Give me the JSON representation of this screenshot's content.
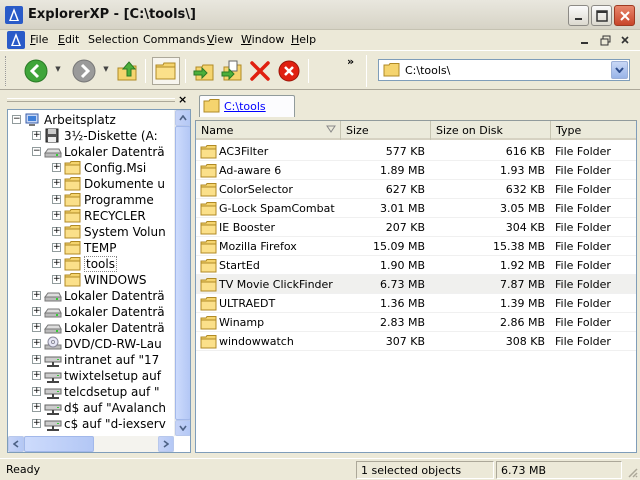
{
  "window": {
    "title": "ExplorerXP - [C:\\tools\\]",
    "app_icon": "app-blue-flame-icon",
    "controls": [
      "minimize-icon",
      "maximize-icon",
      "close-icon"
    ]
  },
  "menubar": {
    "items": [
      {
        "label": "File",
        "u": "F",
        "rest": "ile"
      },
      {
        "label": "Edit",
        "u": "E",
        "rest": "dit"
      },
      {
        "label": "Selection",
        "u": "",
        "rest": "Selection"
      },
      {
        "label": "Commands",
        "u": "",
        "rest": "Commands"
      },
      {
        "label": "View",
        "u": "V",
        "rest": "iew"
      },
      {
        "label": "Window",
        "u": "W",
        "rest": "indow"
      },
      {
        "label": "Help",
        "u": "H",
        "rest": "elp"
      }
    ]
  },
  "toolbar": {
    "buttons": [
      "back-icon",
      "forward-icon",
      "up-folder-icon",
      "folders-icon",
      "move-to-icon",
      "copy-to-icon",
      "delete-icon",
      "cancel-icon"
    ],
    "more": "»"
  },
  "address": {
    "value": "C:\\tools\\"
  },
  "tree": {
    "items": [
      {
        "label": "Arbeitsplatz",
        "level": 0,
        "toggle": "−",
        "icon": "computer-icon"
      },
      {
        "label": "3½-Diskette (A:",
        "level": 1,
        "toggle": "+",
        "icon": "floppy-icon"
      },
      {
        "label": "Lokaler Datenträ",
        "level": 1,
        "toggle": "−",
        "icon": "drive-icon"
      },
      {
        "label": "Config.Msi",
        "level": 2,
        "toggle": "+",
        "icon": "folder-icon"
      },
      {
        "label": "Dokumente u",
        "level": 2,
        "toggle": "+",
        "icon": "folder-icon"
      },
      {
        "label": "Programme",
        "level": 2,
        "toggle": "+",
        "icon": "folder-icon"
      },
      {
        "label": "RECYCLER",
        "level": 2,
        "toggle": "+",
        "icon": "folder-icon"
      },
      {
        "label": "System Volun",
        "level": 2,
        "toggle": "+",
        "icon": "folder-icon"
      },
      {
        "label": "TEMP",
        "level": 2,
        "toggle": "+",
        "icon": "folder-icon"
      },
      {
        "label": "tools",
        "level": 2,
        "toggle": "+",
        "icon": "folder-icon",
        "selected": true
      },
      {
        "label": "WINDOWS",
        "level": 2,
        "toggle": "+",
        "icon": "folder-icon"
      },
      {
        "label": "Lokaler Datenträ",
        "level": 1,
        "toggle": "+",
        "icon": "drive-icon"
      },
      {
        "label": "Lokaler Datenträ",
        "level": 1,
        "toggle": "+",
        "icon": "drive-icon"
      },
      {
        "label": "Lokaler Datenträ",
        "level": 1,
        "toggle": "+",
        "icon": "drive-icon"
      },
      {
        "label": "DVD/CD-RW-Lau",
        "level": 1,
        "toggle": "+",
        "icon": "cd-drive-icon"
      },
      {
        "label": "intranet auf \"17",
        "level": 1,
        "toggle": "+",
        "icon": "network-drive-icon"
      },
      {
        "label": "twixtelsetup auf",
        "level": 1,
        "toggle": "+",
        "icon": "network-drive-icon"
      },
      {
        "label": "telcdsetup auf \"",
        "level": 1,
        "toggle": "+",
        "icon": "network-drive-icon"
      },
      {
        "label": "d$ auf \"Avalanch",
        "level": 1,
        "toggle": "+",
        "icon": "network-drive-icon"
      },
      {
        "label": "c$ auf \"d-iexserv",
        "level": 1,
        "toggle": "+",
        "icon": "network-drive-icon"
      }
    ]
  },
  "tab": {
    "label": "C:\\tools"
  },
  "list": {
    "columns": [
      "Name",
      "Size",
      "Size on Disk",
      "Type"
    ],
    "rows": [
      {
        "name": "AC3Filter",
        "size": "577 KB",
        "disk": "616 KB",
        "type": "File Folder"
      },
      {
        "name": "Ad-aware 6",
        "size": "1.89 MB",
        "disk": "1.93 MB",
        "type": "File Folder"
      },
      {
        "name": "ColorSelector",
        "size": "627 KB",
        "disk": "632 KB",
        "type": "File Folder"
      },
      {
        "name": "G-Lock SpamCombat",
        "size": "3.01 MB",
        "disk": "3.05 MB",
        "type": "File Folder"
      },
      {
        "name": "IE Booster",
        "size": "207 KB",
        "disk": "304 KB",
        "type": "File Folder"
      },
      {
        "name": "Mozilla Firefox",
        "size": "15.09 MB",
        "disk": "15.38 MB",
        "type": "File Folder"
      },
      {
        "name": "StartEd",
        "size": "1.90 MB",
        "disk": "1.92 MB",
        "type": "File Folder"
      },
      {
        "name": "TV Movie ClickFinder",
        "size": "6.73 MB",
        "disk": "7.87 MB",
        "type": "File Folder",
        "selected": true
      },
      {
        "name": "ULTRAEDT",
        "size": "1.36 MB",
        "disk": "1.39 MB",
        "type": "File Folder"
      },
      {
        "name": "Winamp",
        "size": "2.83 MB",
        "disk": "2.86 MB",
        "type": "File Folder"
      },
      {
        "name": "windowwatch",
        "size": "307 KB",
        "disk": "308 KB",
        "type": "File Folder"
      }
    ]
  },
  "status": {
    "state": "Ready",
    "selection": "1 selected objects",
    "size": "6.73 MB"
  },
  "colors": {
    "folder": "#f5d46e",
    "selection_border": "#888888",
    "link": "#0000ff"
  }
}
